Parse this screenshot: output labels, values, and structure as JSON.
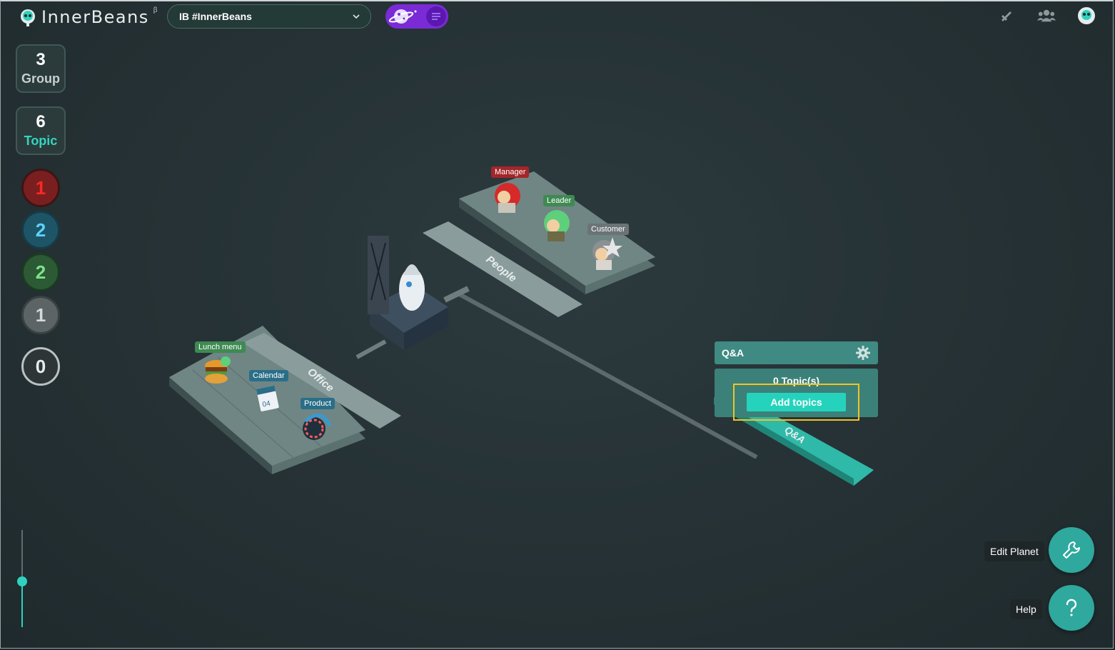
{
  "header": {
    "logo_text": "InnerBeans",
    "logo_beta": "β",
    "planet_select_value": "IB #InnerBeans"
  },
  "sidebar": {
    "group_count": "3",
    "group_label": "Group",
    "topic_count": "6",
    "topic_label": "Topic",
    "filters": [
      {
        "value": "1",
        "color": "#ff2626"
      },
      {
        "value": "2",
        "color": "#5cd2ff"
      },
      {
        "value": "2",
        "color": "#7ee08a"
      },
      {
        "value": "1",
        "color": "#d6d9da"
      },
      {
        "value": "0",
        "color": "#e7ecec"
      }
    ],
    "zoom_level": 0.47
  },
  "scene": {
    "groups": [
      {
        "name": "People",
        "topics": [
          "Manager",
          "Leader",
          "Customer"
        ]
      },
      {
        "name": "Office",
        "topics": [
          "Lunch menu",
          "Calendar",
          "Product"
        ]
      },
      {
        "name": "Q&A",
        "topics": []
      }
    ],
    "tag_colors": {
      "Manager": "#a3262a",
      "Leader": "#3f8a52",
      "Customer": "#6b7376",
      "Lunch menu": "#3f8a52",
      "Calendar": "#2a6e88",
      "Product": "#2a6e88"
    }
  },
  "qa_panel": {
    "title": "Q&A",
    "topic_count": "0 Topic(s)",
    "add_button": "Add topics"
  },
  "actions": {
    "edit_planet": "Edit Planet",
    "help": "Help"
  },
  "colors": {
    "accent": "#2fd2bf",
    "purple_toggle": "#7b2bd6",
    "highlight": "#f2c323"
  }
}
